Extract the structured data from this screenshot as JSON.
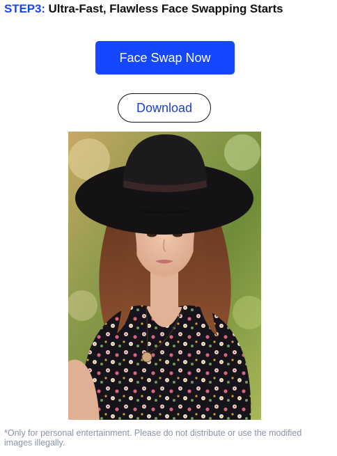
{
  "step": {
    "label": "STEP3:",
    "title": "Ultra-Fast, Flawless Face Swapping Starts"
  },
  "actions": {
    "face_swap_label": "Face Swap Now",
    "download_label": "Download"
  },
  "result_image": {
    "description_icon": "portrait-photo"
  },
  "disclaimer": "*Only for personal entertainment. Please do not distribute or use the modified images illegally.",
  "colors": {
    "accent": "#1447ff",
    "step_label": "#1a47f5",
    "download_text": "#1a3fd6",
    "disclaimer_text": "#8a93a8"
  }
}
